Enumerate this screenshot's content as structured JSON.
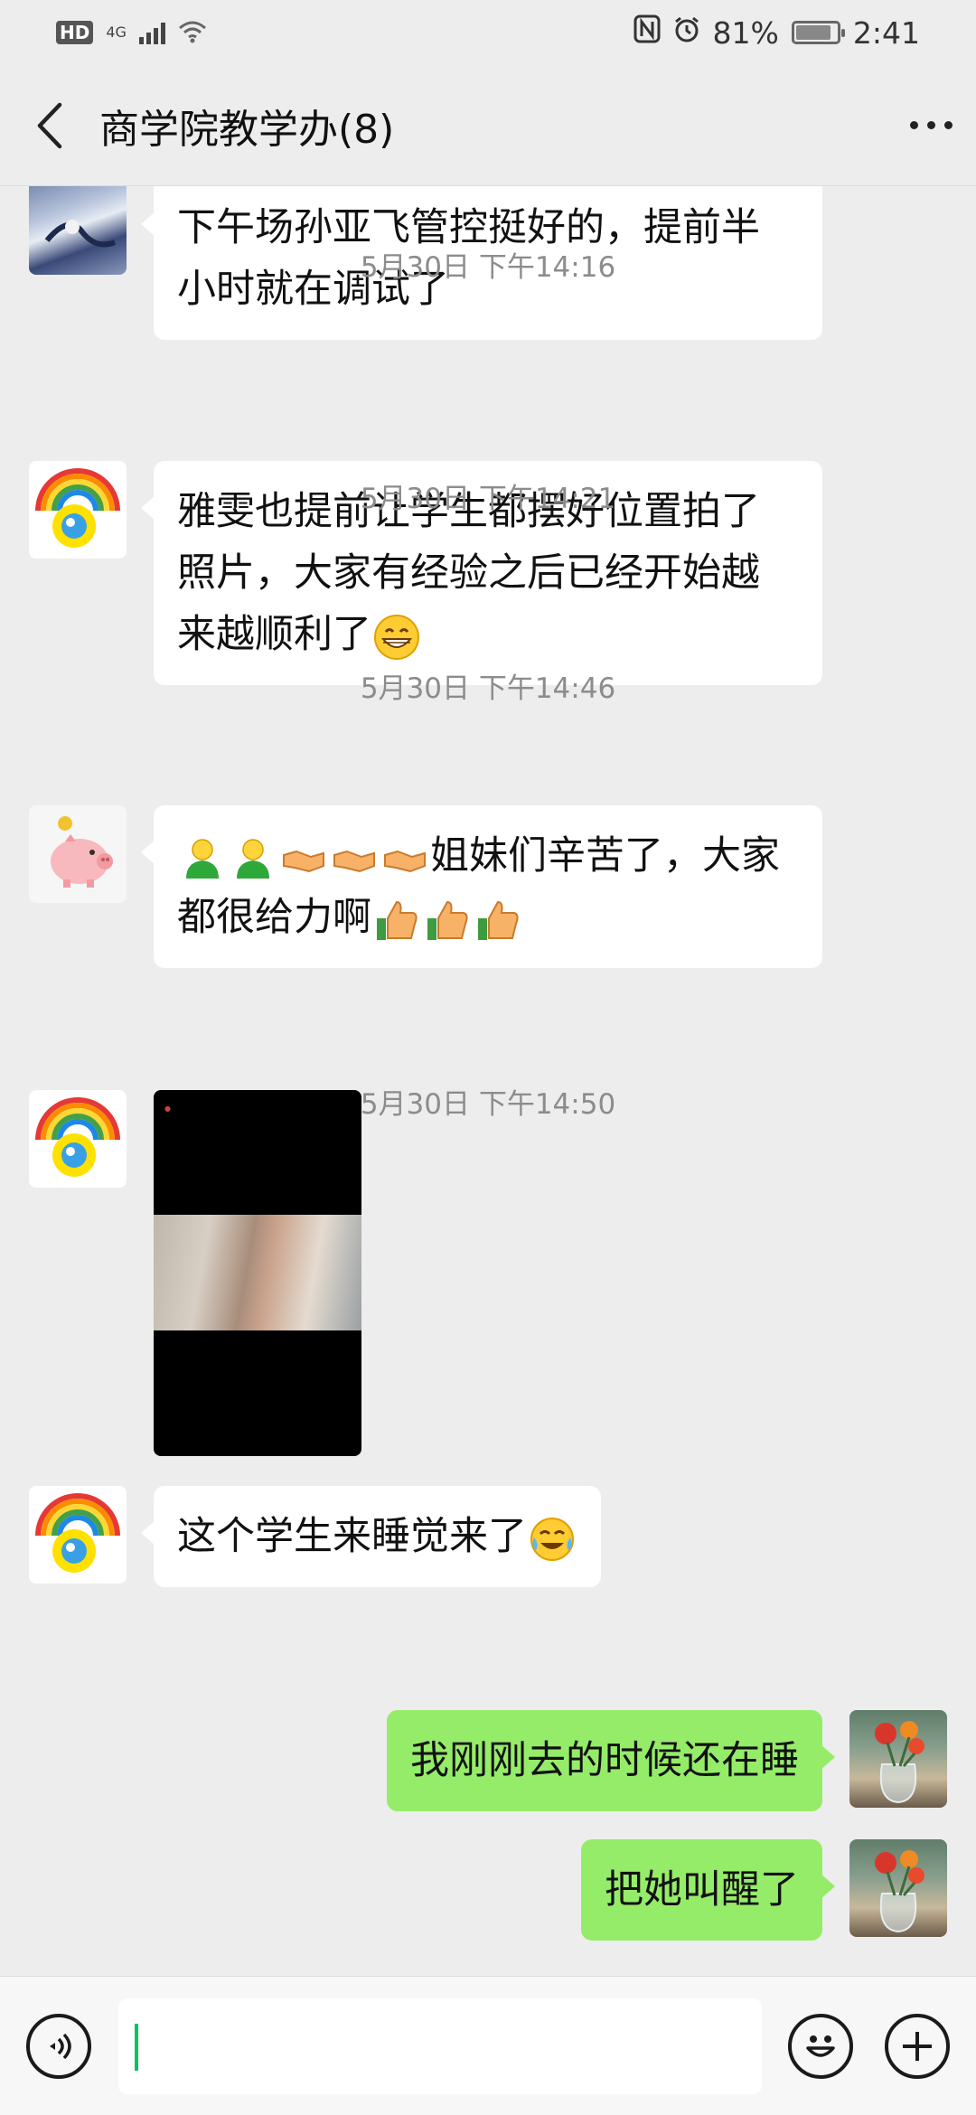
{
  "status_bar": {
    "hd": "HD",
    "network": "4G",
    "battery_percent": "81%",
    "time": "2:41",
    "battery_level": 0.81
  },
  "header": {
    "title": "商学院教学办(8)"
  },
  "messages": [
    {
      "side": "left",
      "text": "下午场孙亚飞管控挺好的，提前半小时就在调试了"
    },
    {
      "timestamp": "5月30日 下午14:16"
    },
    {
      "side": "left",
      "text": "雅雯也提前让学生都摆好位置拍了照片，大家有经验之后已经开始越来越顺利了",
      "emoji": "grin-emoji"
    },
    {
      "timestamp": "5月30日 下午14:21"
    },
    {
      "side": "left",
      "text": "姐妹们辛苦了，大家都很给力啊",
      "emoji": "thumbs-up-emoji"
    },
    {
      "timestamp": "5月30日 下午14:46"
    },
    {
      "side": "left",
      "type": "image"
    },
    {
      "side": "left",
      "text": "这个学生来睡觉来了",
      "emoji": "laugh-cry-emoji"
    },
    {
      "timestamp": "5月30日 下午14:50"
    },
    {
      "side": "right",
      "text": "我刚刚去的时候还在睡"
    },
    {
      "side": "right",
      "text": "把她叫醒了"
    }
  ],
  "bubbles": {
    "m1_l1": "下午场孙亚飞管控挺好的，提前半",
    "m1_l2": "小时就在调试了",
    "m2_l1": "雅雯也提前让学生都摆好位置拍了",
    "m2_l2": "照片，大家有经验之后已经开始越",
    "m2_l3": "来越顺利了",
    "m3_l1": "姐妹们辛苦了，大家",
    "m3_l2": "都很给力啊",
    "m5": "这个学生来睡觉来了",
    "m6": "我刚刚去的时候还在睡",
    "m7": "把她叫醒了"
  },
  "timestamps": {
    "t1": "5月30日 下午14:16",
    "t2": "5月30日 下午14:21",
    "t3": "5月30日 下午14:46",
    "t4": "5月30日 下午14:50"
  },
  "colors": {
    "background": "#ededed",
    "bubble_self": "#95ec69",
    "bubble_other": "#ffffff",
    "cursor": "#07c160"
  },
  "input_bar": {
    "value": ""
  }
}
